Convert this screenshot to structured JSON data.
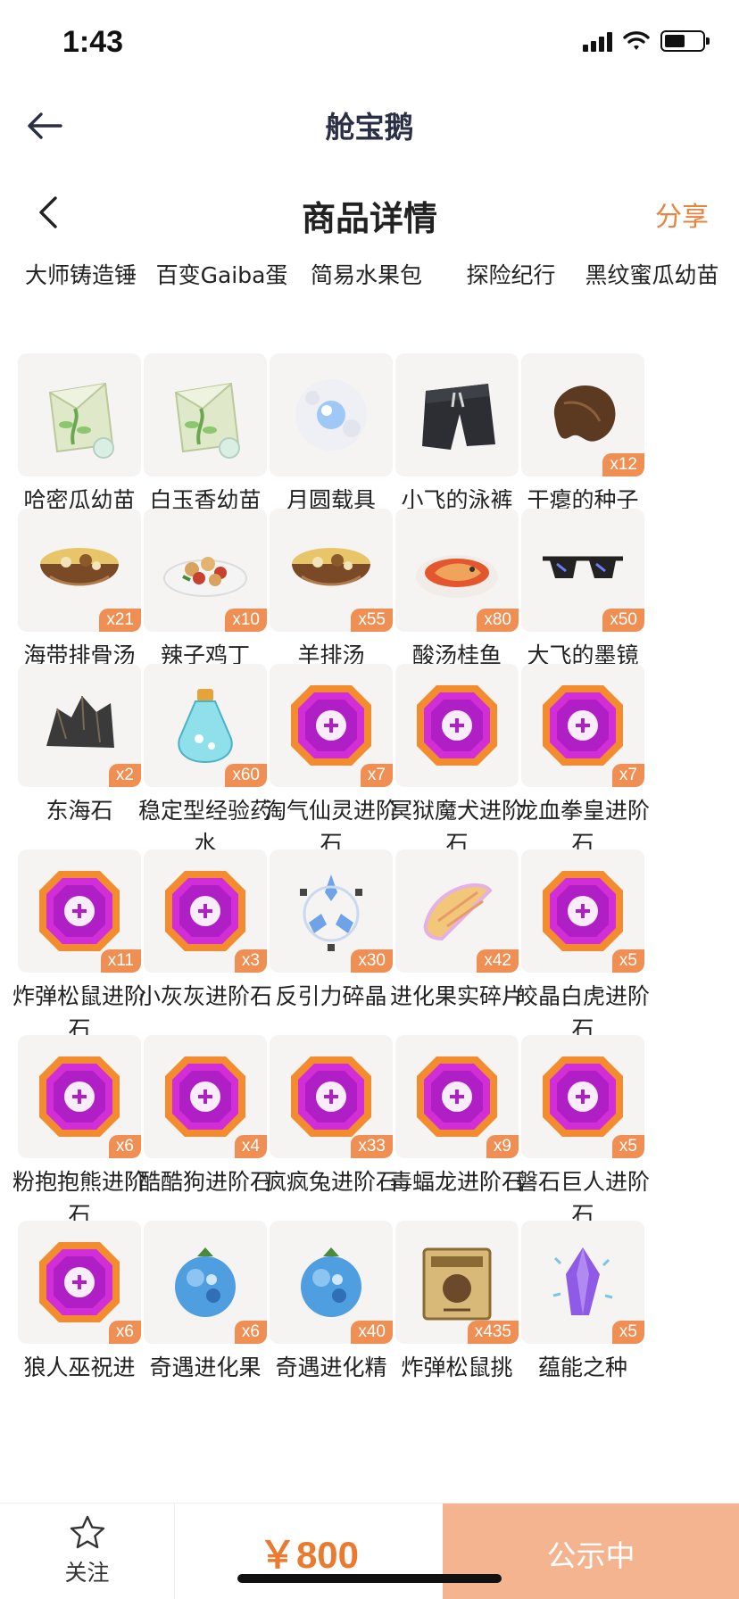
{
  "status_bar": {
    "time": "1:43"
  },
  "app_nav": {
    "title": "舱宝鹅"
  },
  "page_header": {
    "title": "商品详情",
    "share": "分享"
  },
  "partial_items": [
    {
      "name": "大师铸造锤"
    },
    {
      "name": "百变Gaiba蛋"
    },
    {
      "name": "简易水果包"
    },
    {
      "name": "探险纪行"
    },
    {
      "name": "黑纹蜜瓜幼苗"
    }
  ],
  "items": [
    {
      "name": "哈密瓜幼苗",
      "qty": "",
      "icon": "seed-packet-icon"
    },
    {
      "name": "白玉香幼苗",
      "qty": "",
      "icon": "seed-packet-icon"
    },
    {
      "name": "月圆载具",
      "qty": "",
      "icon": "moon-orb-icon"
    },
    {
      "name": "小飞的泳裤",
      "qty": "",
      "icon": "swim-shorts-icon"
    },
    {
      "name": "干瘪的种子",
      "qty": "x12",
      "icon": "dried-seed-icon"
    },
    {
      "name": "海带排骨汤",
      "qty": "x21",
      "icon": "soup-bowl-icon"
    },
    {
      "name": "辣子鸡丁",
      "qty": "x10",
      "icon": "spicy-chicken-icon"
    },
    {
      "name": "羊排汤",
      "qty": "x55",
      "icon": "soup-bowl-icon"
    },
    {
      "name": "酸汤桂鱼",
      "qty": "x80",
      "icon": "fish-dish-icon"
    },
    {
      "name": "大飞的墨镜",
      "qty": "x50",
      "icon": "sunglasses-icon"
    },
    {
      "name": "东海石",
      "qty": "x2",
      "icon": "black-rock-icon"
    },
    {
      "name": "稳定型经验药水",
      "qty": "x60",
      "icon": "potion-icon"
    },
    {
      "name": "淘气仙灵进阶石",
      "qty": "x7",
      "icon": "evolution-gem-icon"
    },
    {
      "name": "冥狱魔犬进阶石",
      "qty": "",
      "icon": "evolution-gem-icon"
    },
    {
      "name": "龙血拳皇进阶石",
      "qty": "x7",
      "icon": "evolution-gem-icon"
    },
    {
      "name": "炸弹松鼠进阶石",
      "qty": "x11",
      "icon": "evolution-gem-icon"
    },
    {
      "name": "小灰灰进阶石",
      "qty": "x3",
      "icon": "evolution-gem-icon"
    },
    {
      "name": "反引力碎晶",
      "qty": "x30",
      "icon": "crystal-shards-icon"
    },
    {
      "name": "进化果实碎片",
      "qty": "x42",
      "icon": "fruit-slice-icon"
    },
    {
      "name": "皎晶白虎进阶石",
      "qty": "x5",
      "icon": "evolution-gem-icon"
    },
    {
      "name": "粉抱抱熊进阶石",
      "qty": "x6",
      "icon": "evolution-gem-icon"
    },
    {
      "name": "酷酷狗进阶石",
      "qty": "x4",
      "icon": "evolution-gem-icon"
    },
    {
      "name": "疯疯兔进阶石",
      "qty": "x33",
      "icon": "evolution-gem-icon"
    },
    {
      "name": "毒蝠龙进阶石",
      "qty": "x9",
      "icon": "evolution-gem-icon"
    },
    {
      "name": "磐石巨人进阶石",
      "qty": "x5",
      "icon": "evolution-gem-icon"
    },
    {
      "name": "狼人巫祝进",
      "qty": "x6",
      "icon": "evolution-gem-icon"
    },
    {
      "name": "奇遇进化果",
      "qty": "x6",
      "icon": "blue-fruit-icon"
    },
    {
      "name": "奇遇进化精",
      "qty": "x40",
      "icon": "blue-fruit-icon"
    },
    {
      "name": "炸弹松鼠挑",
      "qty": "x435",
      "icon": "wanted-scroll-icon"
    },
    {
      "name": "蕴能之种",
      "qty": "x5",
      "icon": "purple-crystal-icon"
    }
  ],
  "bottom_bar": {
    "follow": "关注",
    "price": "￥800",
    "status": "公示中"
  }
}
